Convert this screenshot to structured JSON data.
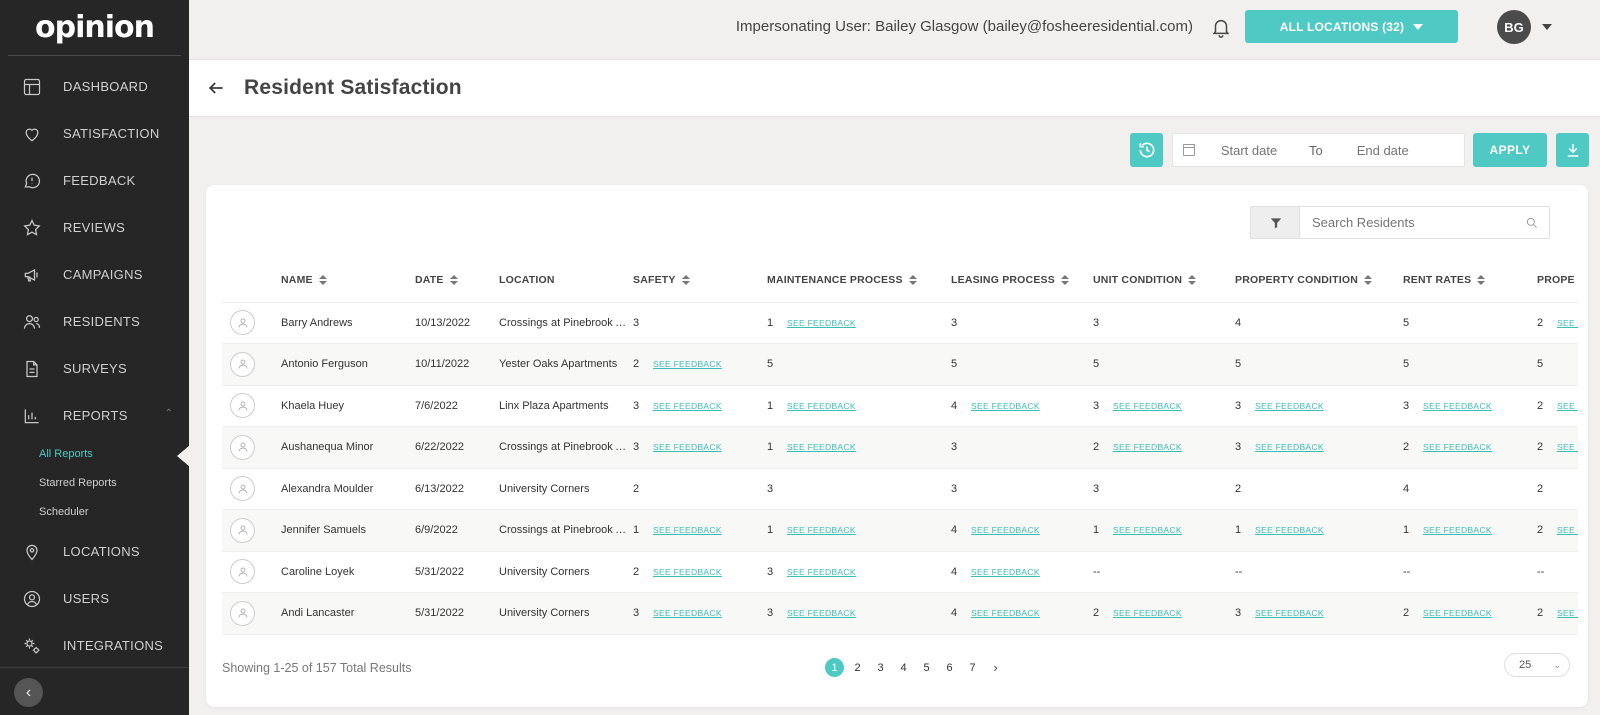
{
  "brand": {
    "logo": "opinion",
    "accent": "#4ec9c4",
    "sidebar_bg": "#262626"
  },
  "sidebar": {
    "items": [
      {
        "key": "dashboard",
        "label": "DASHBOARD",
        "icon": "dashboard-grid-icon"
      },
      {
        "key": "satisfaction",
        "label": "SATISFACTION",
        "icon": "heart-icon"
      },
      {
        "key": "feedback",
        "label": "FEEDBACK",
        "icon": "chat-alert-icon"
      },
      {
        "key": "reviews",
        "label": "REVIEWS",
        "icon": "star-icon"
      },
      {
        "key": "campaigns",
        "label": "CAMPAIGNS",
        "icon": "megaphone-icon"
      },
      {
        "key": "residents",
        "label": "RESIDENTS",
        "icon": "users-icon"
      },
      {
        "key": "surveys",
        "label": "SURVEYS",
        "icon": "document-icon"
      },
      {
        "key": "reports",
        "label": "REPORTS",
        "icon": "bar-chart-icon"
      }
    ],
    "reports_sub": [
      "All Reports",
      "Starred Reports",
      "Scheduler"
    ],
    "items_after": [
      {
        "key": "locations",
        "label": "LOCATIONS",
        "icon": "map-pin-icon"
      },
      {
        "key": "users",
        "label": "USERS",
        "icon": "user-circle-icon"
      },
      {
        "key": "integrations",
        "label": "INTEGRATIONS",
        "icon": "gears-icon"
      }
    ]
  },
  "topbar": {
    "impersonating": "Impersonating User: Bailey Glasgow (bailey@fosheeresidential.com)",
    "locations_button": "ALL LOCATIONS (32)",
    "avatar_initials": "BG"
  },
  "page": {
    "title": "Resident Satisfaction"
  },
  "toolbar": {
    "start_placeholder": "Start date",
    "to_label": "To",
    "end_placeholder": "End date",
    "apply_label": "APPLY"
  },
  "search": {
    "placeholder": "Search Residents"
  },
  "table": {
    "columns": [
      "",
      "NAME",
      "DATE",
      "LOCATION",
      "SAFETY",
      "MAINTENANCE PROCESS",
      "LEASING PROCESS",
      "UNIT CONDITION",
      "PROPERTY CONDITION",
      "RENT RATES",
      "PROPE"
    ],
    "sortable": [
      false,
      true,
      true,
      false,
      true,
      true,
      true,
      true,
      true,
      true,
      false
    ],
    "feedback_link": "SEE FEEDBACK",
    "rows": [
      {
        "name": "Barry Andrews",
        "date": "10/13/2022",
        "location": "Crossings at Pinebrook Apartments",
        "scores": [
          [
            "3",
            false
          ],
          [
            "1",
            true
          ],
          [
            "3",
            false
          ],
          [
            "3",
            false
          ],
          [
            "4",
            false
          ],
          [
            "5",
            false
          ],
          [
            "2",
            true
          ]
        ]
      },
      {
        "name": "Antonio Ferguson",
        "date": "10/11/2022",
        "location": "Yester Oaks Apartments",
        "scores": [
          [
            "2",
            true
          ],
          [
            "5",
            false
          ],
          [
            "5",
            false
          ],
          [
            "5",
            false
          ],
          [
            "5",
            false
          ],
          [
            "5",
            false
          ],
          [
            "5",
            false
          ]
        ]
      },
      {
        "name": "Khaela Huey",
        "date": "7/6/2022",
        "location": "Linx Plaza Apartments",
        "scores": [
          [
            "3",
            true
          ],
          [
            "1",
            true
          ],
          [
            "4",
            true
          ],
          [
            "3",
            true
          ],
          [
            "3",
            true
          ],
          [
            "3",
            true
          ],
          [
            "2",
            true
          ]
        ]
      },
      {
        "name": "Aushanequa Minor",
        "date": "6/22/2022",
        "location": "Crossings at Pinebrook Apartments",
        "scores": [
          [
            "3",
            true
          ],
          [
            "1",
            true
          ],
          [
            "3",
            false
          ],
          [
            "2",
            true
          ],
          [
            "3",
            true
          ],
          [
            "2",
            true
          ],
          [
            "2",
            true
          ]
        ]
      },
      {
        "name": "Alexandra Moulder",
        "date": "6/13/2022",
        "location": "University Corners",
        "scores": [
          [
            "2",
            false
          ],
          [
            "3",
            false
          ],
          [
            "3",
            false
          ],
          [
            "3",
            false
          ],
          [
            "2",
            false
          ],
          [
            "4",
            false
          ],
          [
            "2",
            false
          ]
        ]
      },
      {
        "name": "Jennifer Samuels",
        "date": "6/9/2022",
        "location": "Crossings at Pinebrook Apartments",
        "scores": [
          [
            "1",
            true
          ],
          [
            "1",
            true
          ],
          [
            "4",
            true
          ],
          [
            "1",
            true
          ],
          [
            "1",
            true
          ],
          [
            "1",
            true
          ],
          [
            "2",
            true
          ]
        ]
      },
      {
        "name": "Caroline Loyek",
        "date": "5/31/2022",
        "location": "University Corners",
        "scores": [
          [
            "2",
            true
          ],
          [
            "3",
            true
          ],
          [
            "4",
            true
          ],
          [
            "--",
            false
          ],
          [
            "--",
            false
          ],
          [
            "--",
            false
          ],
          [
            "--",
            false
          ]
        ]
      },
      {
        "name": "Andi Lancaster",
        "date": "5/31/2022",
        "location": "University Corners",
        "scores": [
          [
            "3",
            true
          ],
          [
            "3",
            true
          ],
          [
            "4",
            true
          ],
          [
            "2",
            true
          ],
          [
            "3",
            true
          ],
          [
            "2",
            true
          ],
          [
            "2",
            true
          ]
        ]
      }
    ]
  },
  "footer": {
    "showing": "Showing 1-25 of 157 Total Results",
    "pages": [
      "1",
      "2",
      "3",
      "4",
      "5",
      "6",
      "7"
    ],
    "current_page": "1",
    "page_size": "25"
  }
}
